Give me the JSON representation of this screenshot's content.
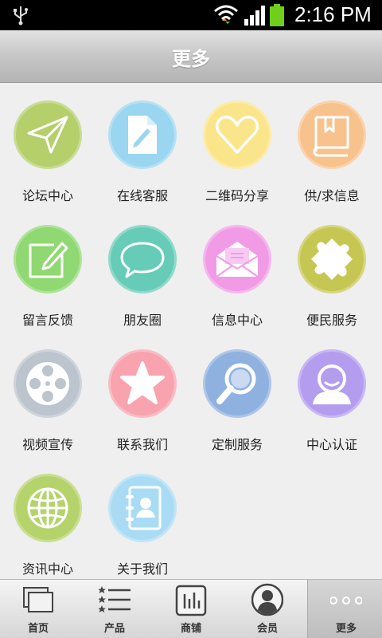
{
  "status_bar": {
    "time": "2:16 PM"
  },
  "header": {
    "title": "更多"
  },
  "tiles": [
    {
      "label": "论坛中心",
      "icon": "paper-plane-icon",
      "color": "#b5cf6a"
    },
    {
      "label": "在线客服",
      "icon": "document-edit-icon",
      "color": "#9ad6f0"
    },
    {
      "label": "二维码分享",
      "icon": "heart-icon",
      "color": "#fbe58a"
    },
    {
      "label": "供/求信息",
      "icon": "book-icon",
      "color": "#f8c28c"
    },
    {
      "label": "留言反馈",
      "icon": "note-edit-icon",
      "color": "#8fd872"
    },
    {
      "label": "朋友圈",
      "icon": "speech-bubble-icon",
      "color": "#66ccb8"
    },
    {
      "label": "信息中心",
      "icon": "envelope-icon",
      "color": "#f19be6"
    },
    {
      "label": "便民服务",
      "icon": "puzzle-icon",
      "color": "#c6c652"
    },
    {
      "label": "视频宣传",
      "icon": "film-reel-icon",
      "color": "#bcc4ce"
    },
    {
      "label": "联系我们",
      "icon": "star-icon",
      "color": "#f8a3ae"
    },
    {
      "label": "定制服务",
      "icon": "magnifier-icon",
      "color": "#8fb1e0"
    },
    {
      "label": "中心认证",
      "icon": "user-icon",
      "color": "#b49cef"
    },
    {
      "label": "资讯中心",
      "icon": "globe-icon",
      "color": "#b5d36b"
    },
    {
      "label": "关于我们",
      "icon": "contacts-book-icon",
      "color": "#a9dcf4"
    }
  ],
  "tabbar": [
    {
      "label": "首页",
      "icon": "home-cards-icon"
    },
    {
      "label": "产品",
      "icon": "starred-list-icon"
    },
    {
      "label": "商铺",
      "icon": "shop-chart-icon"
    },
    {
      "label": "会员",
      "icon": "member-icon"
    },
    {
      "label": "更多",
      "icon": "more-dots-icon",
      "active": true
    }
  ]
}
